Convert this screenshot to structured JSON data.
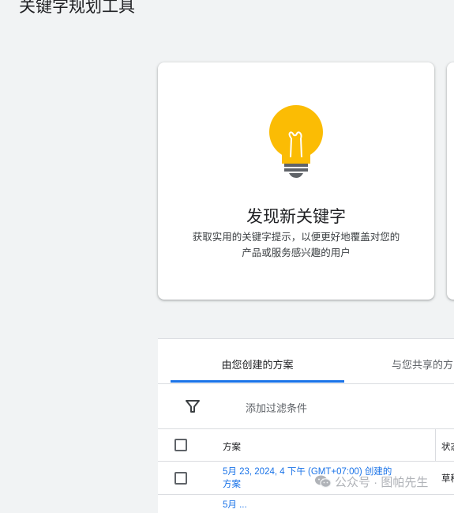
{
  "page": {
    "title": "关键字规划工具"
  },
  "discover_card": {
    "icon": "lightbulb-icon",
    "title": "发现新关键字",
    "description_line1": "获取实用的关键字提示，以便更好地覆盖对您的",
    "description_line2": "产品或服务感兴趣的用户"
  },
  "plans": {
    "tabs": [
      {
        "label": "由您创建的方案",
        "selected": true
      },
      {
        "label": "与您共享的方",
        "selected": false
      }
    ],
    "filter": {
      "icon": "filter-icon",
      "label": "添加过滤条件"
    },
    "columns": {
      "plan": "方案",
      "status": "状态"
    },
    "rows": [
      {
        "plan_line1": "5月 23, 2024, 4 下午 (GMT+07:00) 创建的",
        "plan_line2": "方案",
        "status": "草稿"
      },
      {
        "plan_line1": "5月 ..."
      }
    ]
  },
  "watermark": {
    "icon": "wechat-icon",
    "text": "公众号 · 图帕先生"
  },
  "colors": {
    "accent": "#1a73e8",
    "bulb": "#fbbc04",
    "background": "#f1f3f4"
  }
}
